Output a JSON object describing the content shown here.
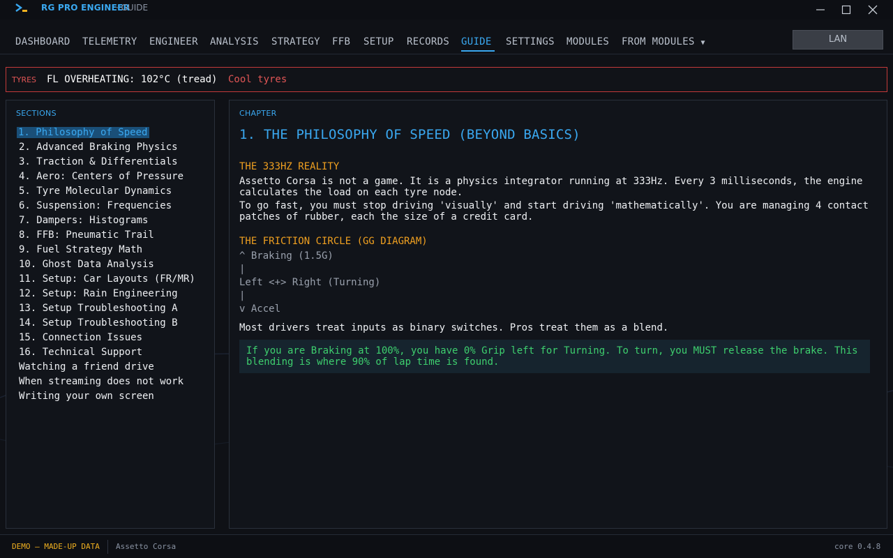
{
  "window": {
    "title": "RG PRO ENGINEER",
    "subtitle": "· GUIDE",
    "logo_icon": "terminal-logo-icon",
    "controls": [
      "minimize-icon",
      "maximize-icon",
      "close-icon"
    ]
  },
  "nav": {
    "items": [
      "DASHBOARD",
      "TELEMETRY",
      "ENGINEER",
      "ANALYSIS",
      "STRATEGY",
      "FFB",
      "SETUP",
      "RECORDS",
      "GUIDE",
      "SETTINGS",
      "MODULES",
      "FROM MODULES"
    ],
    "active": "GUIDE",
    "dropdown_icon": "caret-down-icon",
    "lan_button": "LAN"
  },
  "alert": {
    "tag": "TYRES",
    "message": "FL OVERHEATING: 102°C (tread)",
    "action": "Cool tyres",
    "color": "#e05555"
  },
  "sections": {
    "label": "SECTIONS",
    "items": [
      "1. Philosophy of Speed",
      "2. Advanced Braking Physics",
      "3. Traction & Differentials",
      "4. Aero: Centers of Pressure",
      "5. Tyre Molecular Dynamics",
      "6. Suspension: Frequencies",
      "7. Dampers: Histograms",
      "8. FFB: Pneumatic Trail",
      "9. Fuel Strategy Math",
      "10. Ghost Data Analysis",
      "11. Setup: Car Layouts (FR/MR)",
      "12. Setup: Rain Engineering",
      "13. Setup Troubleshooting A",
      "14. Setup Troubleshooting B",
      "15. Connection Issues",
      "16. Technical Support",
      "Watching a friend drive",
      "When streaming does not work",
      "Writing your own screen"
    ],
    "active_index": 0
  },
  "chapter": {
    "label": "CHAPTER",
    "title": "1. THE PHILOSOPHY OF SPEED (BEYOND BASICS)",
    "h1": "THE 333HZ REALITY",
    "p1": "Assetto Corsa is not a game. It is a physics integrator running at 333Hz. Every 3 milliseconds, the engine calculates the load on each tyre node.",
    "p2": "To go fast, you must stop driving 'visually' and start driving 'mathematically'. You are managing 4 contact patches of rubber, each the size of a credit card.",
    "h2": "THE FRICTION CIRCLE (GG DIAGRAM)",
    "diagram": [
      "^ Braking (1.5G)",
      "|",
      "Left <+> Right (Turning)",
      "|",
      "v Accel"
    ],
    "p3": "Most drivers treat inputs as binary switches. Pros treat them as a blend.",
    "tip": "If you are Braking at 100%, you have 0% Grip left for Turning. To turn, you MUST release the brake. This blending is where 90% of lap time is found."
  },
  "status": {
    "demo": "DEMO — MADE-UP DATA",
    "game": "Assetto Corsa",
    "version": "core 0.4.8"
  },
  "colors": {
    "accent": "#3aa8f0",
    "heading": "#f0a020",
    "tip_text": "#3ecf6e",
    "alert": "#e05555"
  }
}
